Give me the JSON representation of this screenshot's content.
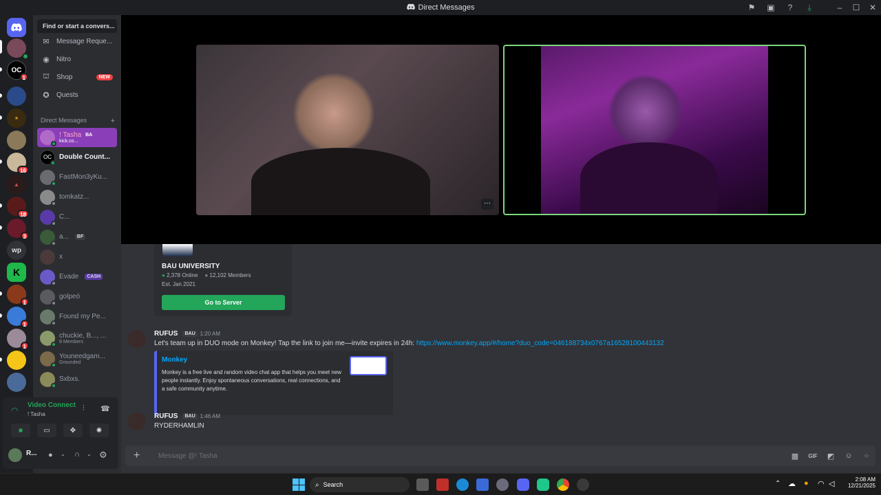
{
  "window": {
    "title": "Direct Messages"
  },
  "guilds": {
    "badges": [
      "1",
      "16",
      "18",
      "3",
      "1",
      "1",
      "1"
    ],
    "wp_label": "wp"
  },
  "dm_panel": {
    "search_placeholder": "Find or start a convers...",
    "nav": {
      "message_requests": "Message Reque...",
      "nitro": "Nitro",
      "shop": "Shop",
      "shop_badge": "NEW",
      "quests": "Quests"
    },
    "header": "Direct Messages",
    "add_icon": "+",
    "items": [
      {
        "name": "! Tasha",
        "tag": "BA",
        "sub": "kick.co...",
        "active": true
      },
      {
        "name": "Double Count...",
        "bold": true
      },
      {
        "name": "FastMon3yKu..."
      },
      {
        "name": "tomkatz..."
      },
      {
        "name": "C..."
      },
      {
        "name": "a...",
        "tag": "BF"
      },
      {
        "name": "x"
      },
      {
        "name": "Evade",
        "tag": "CASH"
      },
      {
        "name": "golpeó"
      },
      {
        "name": "Found my Pe..."
      },
      {
        "name": "chuckie, B..., ...",
        "sub": "9 Members"
      },
      {
        "name": "Youneedgam...",
        "sub": "Grounded"
      },
      {
        "name": "Sxbxs."
      }
    ]
  },
  "voice": {
    "status": "Video Connecte",
    "channel": "! Tasha"
  },
  "user": {
    "name": "R..."
  },
  "chat": {
    "server_card": {
      "name": "BAU UNIVERSITY",
      "online": "2,378 Online",
      "members": "12,102 Members",
      "established": "Est. Jan 2021",
      "button": "Go to Server"
    },
    "messages": [
      {
        "author": "RUFUS",
        "tag": "BAU",
        "time": "1:20 AM",
        "text": "Let's team up in DUO mode on Monkey! Tap the link to join me—invite expires in 24h: ",
        "link": "https://www.monkey.app/#/home?duo_code=046188734x0767a16528100443132",
        "embed": {
          "title": "Monkey",
          "description": "Monkey is a free live and random video chat app that helps you meet new people instantly. Enjoy spontaneous conversations, real connections, and a safe community anytime."
        }
      },
      {
        "author": "RUFUS",
        "tag": "BAU",
        "time": "1:46 AM",
        "text": "RYDERHAMLIN"
      }
    ],
    "composer_placeholder": "Message @! Tasha"
  },
  "taskbar": {
    "search": "Search",
    "time": "2:08 AM",
    "date": "12/21/2025"
  },
  "colors": {
    "blurple": "#5865f2",
    "online": "#23a55a",
    "red": "#f23f43",
    "link": "#00a8fc",
    "active_dm": "#8a3fb8",
    "speaking": "#7dd87d"
  }
}
